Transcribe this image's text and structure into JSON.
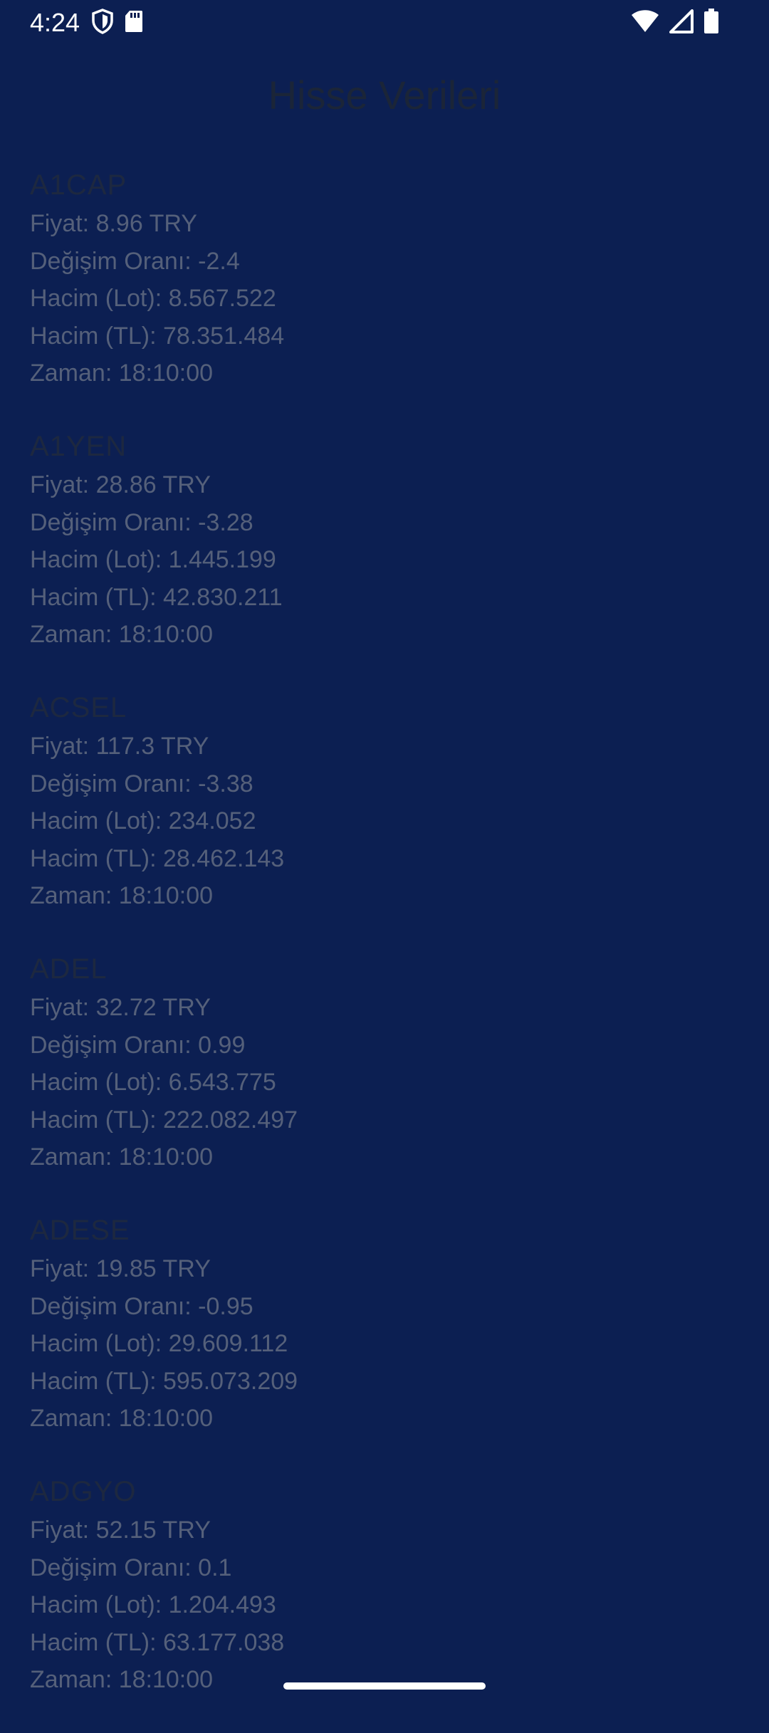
{
  "status_bar": {
    "time": "4:24",
    "left_icons": [
      "shield-icon",
      "sd-card-icon"
    ],
    "right_icons": [
      "wifi-icon",
      "cellular-signal-icon",
      "battery-icon"
    ]
  },
  "page": {
    "title": "Hisse Verileri"
  },
  "stocks": [
    {
      "symbol": "A1CAP",
      "price": "Fiyat: 8.96 TRY",
      "change": "Değişim Oranı: -2.4",
      "volume_lot": "Hacim (Lot): 8.567.522",
      "volume_tl": "Hacim (TL): 78.351.484",
      "time": "Zaman: 18:10:00"
    },
    {
      "symbol": "A1YEN",
      "price": "Fiyat: 28.86 TRY",
      "change": "Değişim Oranı: -3.28",
      "volume_lot": "Hacim (Lot): 1.445.199",
      "volume_tl": "Hacim (TL): 42.830.211",
      "time": "Zaman: 18:10:00"
    },
    {
      "symbol": "ACSEL",
      "price": "Fiyat: 117.3 TRY",
      "change": "Değişim Oranı: -3.38",
      "volume_lot": "Hacim (Lot): 234.052",
      "volume_tl": "Hacim (TL): 28.462.143",
      "time": "Zaman: 18:10:00"
    },
    {
      "symbol": "ADEL",
      "price": "Fiyat: 32.72 TRY",
      "change": "Değişim Oranı: 0.99",
      "volume_lot": "Hacim (Lot): 6.543.775",
      "volume_tl": "Hacim (TL): 222.082.497",
      "time": "Zaman: 18:10:00"
    },
    {
      "symbol": "ADESE",
      "price": "Fiyat: 19.85 TRY",
      "change": "Değişim Oranı: -0.95",
      "volume_lot": "Hacim (Lot): 29.609.112",
      "volume_tl": "Hacim (TL): 595.073.209",
      "time": "Zaman: 18:10:00"
    },
    {
      "symbol": "ADGYO",
      "price": "Fiyat: 52.15 TRY",
      "change": "Değişim Oranı: 0.1",
      "volume_lot": "Hacim (Lot): 1.204.493",
      "volume_tl": "Hacim (TL): 63.177.038",
      "time": "Zaman: 18:10:00"
    }
  ],
  "colors": {
    "background": "#0c1f52",
    "title_text": "#1b2538",
    "symbol_text": "#1d2840",
    "detail_text": "#55607a",
    "status_text": "#ffffff"
  }
}
